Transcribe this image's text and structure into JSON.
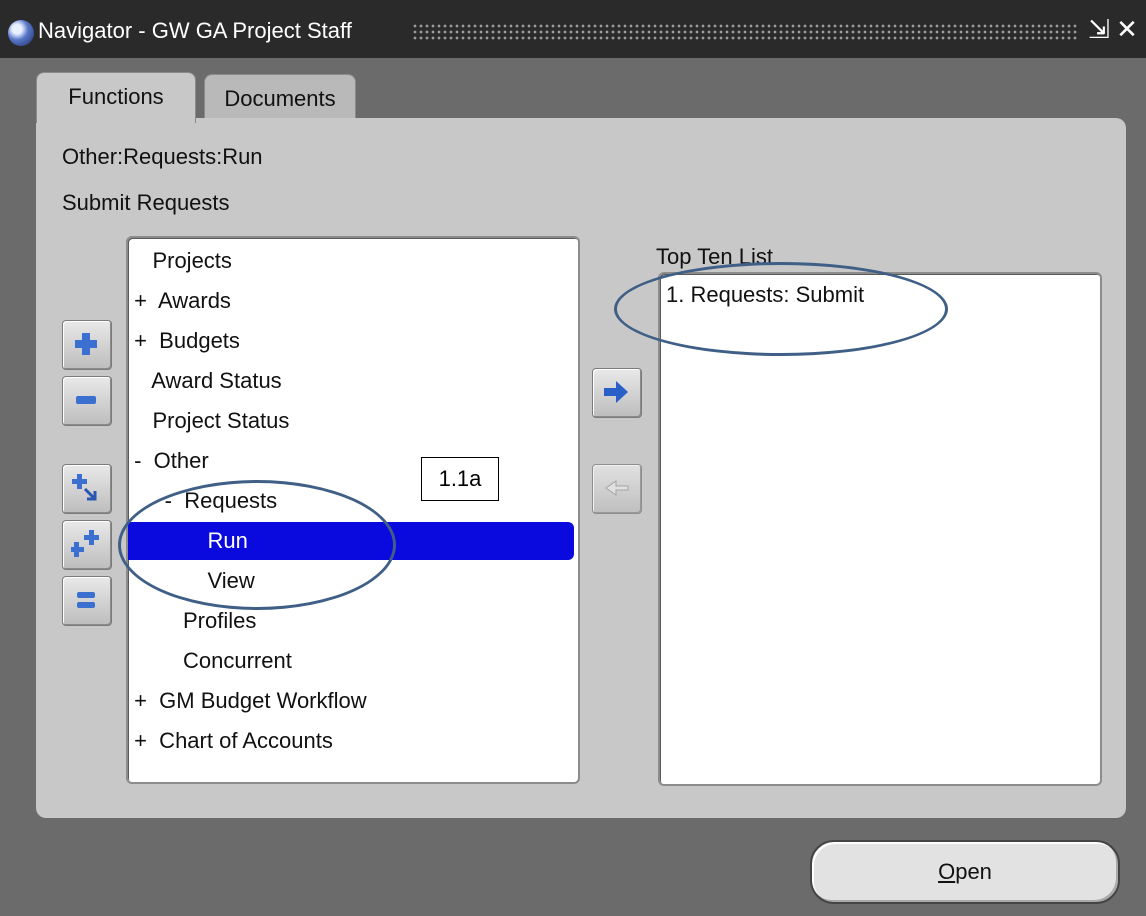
{
  "window": {
    "title": "Navigator - GW GA Project Staff",
    "minimize_glyph": "⇲",
    "close_glyph": "✕"
  },
  "tabs": [
    {
      "label": "Functions",
      "active": true
    },
    {
      "label": "Documents",
      "active": false
    }
  ],
  "breadcrumb": "Other:Requests:Run",
  "description": "Submit Requests",
  "tree": [
    {
      "text": "    Projects",
      "selected": false
    },
    {
      "text": " +  Awards",
      "selected": false
    },
    {
      "text": " +  Budgets",
      "selected": false
    },
    {
      "text": "    Award Status",
      "selected": false
    },
    {
      "text": "    Project Status",
      "selected": false
    },
    {
      "text": " -  Other",
      "selected": false
    },
    {
      "text": "      -  Requests",
      "selected": false
    },
    {
      "text": "             Run",
      "selected": true
    },
    {
      "text": "             View",
      "selected": false
    },
    {
      "text": "         Profiles",
      "selected": false
    },
    {
      "text": "         Concurrent",
      "selected": false
    },
    {
      "text": " +  GM Budget Workflow",
      "selected": false
    },
    {
      "text": " +  Chart of Accounts",
      "selected": false
    }
  ],
  "top_ten": {
    "label": "Top Ten List",
    "items": [
      "1. Requests: Submit"
    ]
  },
  "annotation_label": "1.1a",
  "open_button": {
    "accesskey": "O",
    "rest": "pen"
  },
  "colors": {
    "selection": "#0a0adf",
    "annotation": "#3f5f86",
    "panel": "#c8c8c8",
    "titlebar": "#2a2a2a"
  },
  "icons": [
    "expand-icon",
    "collapse-icon",
    "expand-branch-icon",
    "expand-all-icon",
    "collapse-all-icon",
    "add-to-list-arrow-icon",
    "remove-from-list-arrow-icon"
  ]
}
